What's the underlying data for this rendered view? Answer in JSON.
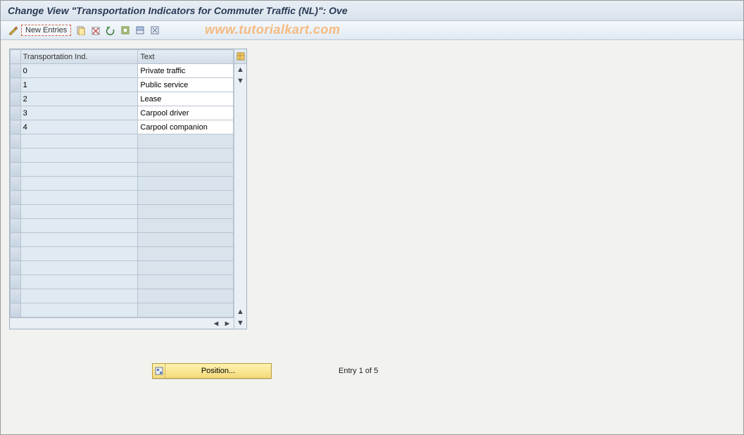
{
  "title": "Change View \"Transportation Indicators for Commuter Traffic (NL)\": Ove",
  "toolbar": {
    "new_entries": "New Entries"
  },
  "watermark": "www.tutorialkart.com",
  "grid": {
    "columns": [
      "Transportation Ind.",
      "Text"
    ],
    "rows": [
      {
        "ind": "0",
        "text": "Private traffic"
      },
      {
        "ind": "1",
        "text": "Public service"
      },
      {
        "ind": "2",
        "text": "Lease"
      },
      {
        "ind": "3",
        "text": "Carpool driver"
      },
      {
        "ind": "4",
        "text": "Carpool companion"
      }
    ]
  },
  "position_btn": "Position...",
  "entry_status": "Entry 1 of 5"
}
